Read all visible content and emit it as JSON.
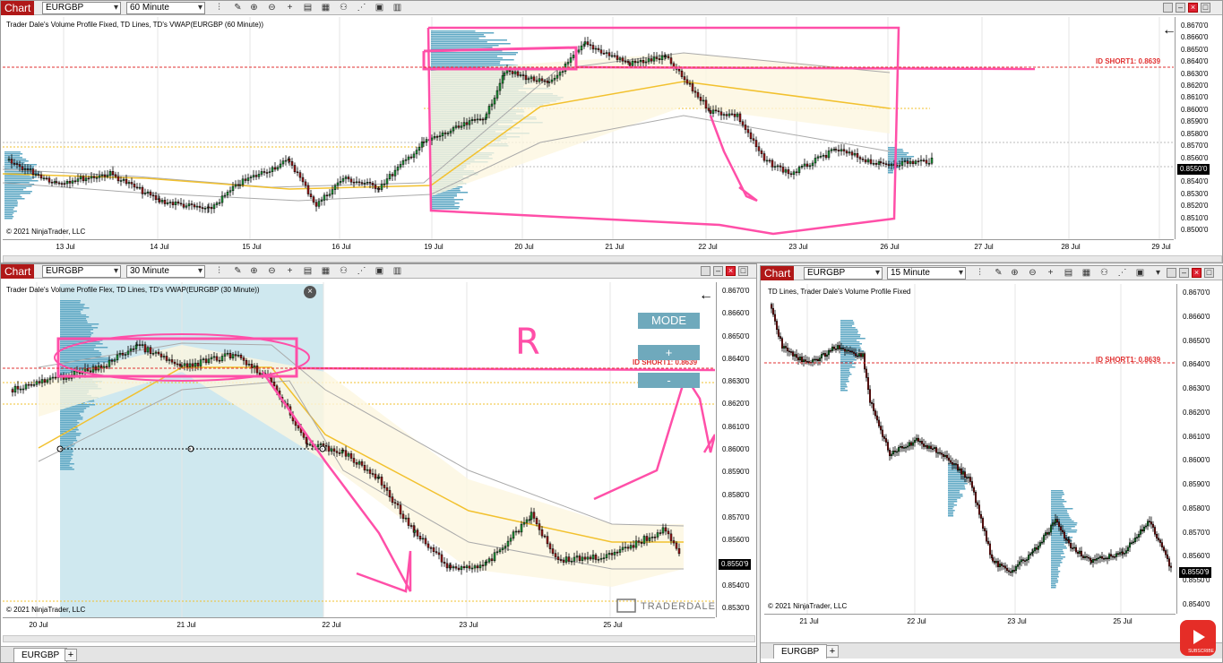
{
  "chart_label": "Chart",
  "pane1": {
    "symbol": "EURGBP",
    "interval": "60 Minute",
    "indicators": "Trader Dale's Volume Profile Fixed, TD Lines, TD's VWAP(EURGBP (60 Minute))",
    "copyright": "© 2021 NinjaTrader, LLC",
    "price_tag": "0.8550'0",
    "id_label": "ID SHORT1: 0.8639",
    "y_labels": [
      "0.8670'0",
      "0.8660'0",
      "0.8650'0",
      "0.8640'0",
      "0.8630'0",
      "0.8620'0",
      "0.8610'0",
      "0.8600'0",
      "0.8590'0",
      "0.8580'0",
      "0.8570'0",
      "0.8560'0",
      "0.8550'0",
      "0.8540'0",
      "0.8530'0",
      "0.8520'0",
      "0.8510'0",
      "0.8500'0"
    ],
    "x_labels": [
      "13 Jul",
      "14 Jul",
      "15 Jul",
      "16 Jul",
      "19 Jul",
      "20 Jul",
      "21 Jul",
      "22 Jul",
      "23 Jul",
      "26 Jul",
      "27 Jul",
      "28 Jul",
      "29 Jul"
    ]
  },
  "pane2": {
    "symbol": "EURGBP",
    "interval": "30 Minute",
    "indicators": "Trader Dale's Volume Profile Flex, TD Lines, TD's VWAP(EURGBP (30 Minute))",
    "copyright": "© 2021 NinjaTrader, LLC",
    "price_tag": "0.8550'9",
    "id_label": "ID SHORT1: 0.8639",
    "mode_label": "MODE",
    "plus_label": "+",
    "minus_label": "-",
    "annotation": "R",
    "logo": "TRADERDALE",
    "tab": "EURGBP",
    "y_labels": [
      "0.8670'0",
      "0.8660'0",
      "0.8650'0",
      "0.8640'0",
      "0.8630'0",
      "0.8620'0",
      "0.8610'0",
      "0.8600'0",
      "0.8590'0",
      "0.8580'0",
      "0.8570'0",
      "0.8560'0",
      "0.8550'0",
      "0.8540'0",
      "0.8530'0"
    ],
    "x_labels": [
      "20 Jul",
      "21 Jul",
      "22 Jul",
      "23 Jul",
      "25 Jul"
    ]
  },
  "pane3": {
    "symbol": "EURGBP",
    "interval": "15 Minute",
    "indicators": "TD Lines, Trader Dale's Volume Profile Fixed",
    "copyright": "© 2021 NinjaTrader, LLC",
    "price_tag": "0.8550'9",
    "id_label": "ID SHORT1: 0.8639",
    "tab": "EURGBP",
    "y_labels": [
      "0.8670'0",
      "0.8660'0",
      "0.8650'0",
      "0.8640'0",
      "0.8630'0",
      "0.8620'0",
      "0.8610'0",
      "0.8600'0",
      "0.8590'0",
      "0.8580'0",
      "0.8570'0",
      "0.8560'0",
      "0.8550'0",
      "0.8540'0"
    ],
    "x_labels": [
      "21 Jul",
      "22 Jul",
      "23 Jul",
      "25 Jul"
    ]
  },
  "youtube_badge": "SUBSCRIBE",
  "colors": {
    "accent": "#b01818",
    "annotation": "#ff4fa8",
    "profile": "#5fa8c4",
    "vwap": "#f2c12e",
    "band": "#aaaaaa",
    "id_line": "#e03030"
  }
}
